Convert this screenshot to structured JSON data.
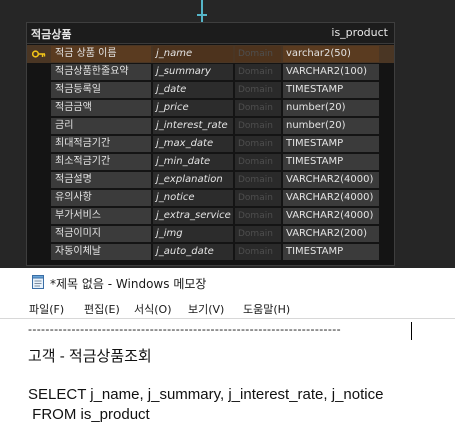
{
  "entity": {
    "logical_name": "적금상품",
    "physical_name": "is_product",
    "columns": [
      {
        "logical": "적금 상품 이름",
        "physical": "j_name",
        "domain": "Domain",
        "type": "varchar2(50)",
        "pk": true
      },
      {
        "logical": "적금상품한줄요약",
        "physical": "j_summary",
        "domain": "Domain",
        "type": "VARCHAR2(100)",
        "pk": false
      },
      {
        "logical": "적금등록일",
        "physical": "j_date",
        "domain": "Domain",
        "type": "TIMESTAMP",
        "pk": false
      },
      {
        "logical": "적금금액",
        "physical": "j_price",
        "domain": "Domain",
        "type": "number(20)",
        "pk": false
      },
      {
        "logical": "금리",
        "physical": "j_interest_rate",
        "domain": "Domain",
        "type": "number(20)",
        "pk": false
      },
      {
        "logical": "최대적금기간",
        "physical": "j_max_date",
        "domain": "Domain",
        "type": "TIMESTAMP",
        "pk": false
      },
      {
        "logical": "최소적금기간",
        "physical": "j_min_date",
        "domain": "Domain",
        "type": "TIMESTAMP",
        "pk": false
      },
      {
        "logical": "적금설명",
        "physical": "j_explanation",
        "domain": "Domain",
        "type": "VARCHAR2(4000)",
        "pk": false
      },
      {
        "logical": "유의사항",
        "physical": "j_notice",
        "domain": "Domain",
        "type": "VARCHAR2(4000)",
        "pk": false
      },
      {
        "logical": "부가서비스",
        "physical": "j_extra_service",
        "domain": "Domain",
        "type": "VARCHAR2(4000)",
        "pk": false
      },
      {
        "logical": "적금이미지",
        "physical": "j_img",
        "domain": "Domain",
        "type": "VARCHAR2(200)",
        "pk": false
      },
      {
        "logical": "자동이체날",
        "physical": "j_auto_date",
        "domain": "Domain",
        "type": "TIMESTAMP",
        "pk": false
      }
    ]
  },
  "notepad": {
    "title": "*제목 없음 - Windows 메모장",
    "menu": [
      "파일(F)",
      "편집(E)",
      "서식(O)",
      "보기(V)",
      "도움말(H)"
    ],
    "lines": {
      "dashes": "------------------------------------------------------------------------",
      "heading": "고객 - 적금상품조회",
      "sql1": "SELECT j_name, j_summary, j_interest_rate, j_notice",
      "sql2": " FROM is_product"
    }
  },
  "icons": {
    "primary_key": "key-icon",
    "notepad_app": "notepad-icon"
  },
  "colors": {
    "pk_row": "#5a3b20",
    "connector": "#55b5c8"
  }
}
